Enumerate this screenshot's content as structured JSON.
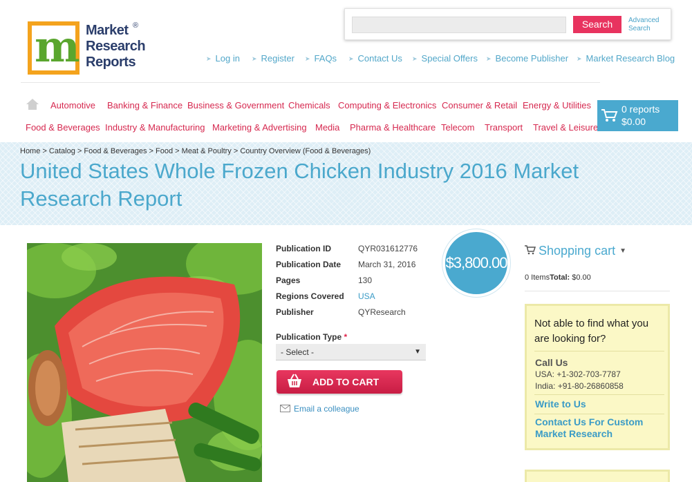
{
  "logo": {
    "line1": "Market",
    "line2": "Research",
    "line3": "Reports",
    "mark": "®"
  },
  "search": {
    "placeholder": "",
    "button": "Search",
    "advanced_line1": "Advanced",
    "advanced_line2": "Search"
  },
  "top_nav": [
    "Log in",
    "Register",
    "FAQs",
    "Contact Us",
    "Special Offers",
    "Become Publisher",
    "Market Research Blog"
  ],
  "categories_row1": [
    "Automotive",
    "Banking & Finance",
    "Business & Government",
    "Chemicals",
    "Computing & Electronics",
    "Consumer & Retail",
    "Energy & Utilities"
  ],
  "categories_row2": [
    "Food & Beverages",
    "Industry & Manufacturing",
    "Marketing & Advertising",
    "Media",
    "Pharma & Healthcare",
    "Telecom",
    "Transport",
    "Travel & Leisure"
  ],
  "cart": {
    "reports": "0 reports",
    "amount": "$0.00"
  },
  "breadcrumb": [
    "Home",
    "Catalog",
    "Food & Beverages",
    "Food",
    "Meat & Poultry",
    "Country Overview (Food & Beverages)"
  ],
  "title": "United States Whole Frozen Chicken Industry 2016 Market Research Report",
  "details": [
    {
      "label": "Publication ID",
      "value": "QYR031612776"
    },
    {
      "label": "Publication Date",
      "value": "March 31, 2016"
    },
    {
      "label": "Pages",
      "value": "130"
    },
    {
      "label": "Regions Covered",
      "value": "USA"
    },
    {
      "label": "Publisher",
      "value": "QYResearch"
    }
  ],
  "publication_type": {
    "label": "Publication Type",
    "required": "*",
    "selected": "- Select -"
  },
  "add_to_cart": "ADD TO CART",
  "email_colleague": "Email a colleague",
  "price": "$3,800.00",
  "shopping_cart": {
    "title": "Shopping cart",
    "items": "0 Items",
    "total_label": "Total:",
    "total": "$0.00"
  },
  "help": {
    "title": "Not able to find what you are looking for?",
    "call_us": "Call Us",
    "usa": "USA: +1-302-703-7787",
    "india": "India: +91-80-26860858",
    "write": "Write to Us",
    "custom": "Contact Us For Custom Market Research"
  },
  "colors": {
    "accent_blue": "#4aa9cf",
    "accent_red": "#e8335f",
    "logo_orange": "#f4a31d"
  }
}
